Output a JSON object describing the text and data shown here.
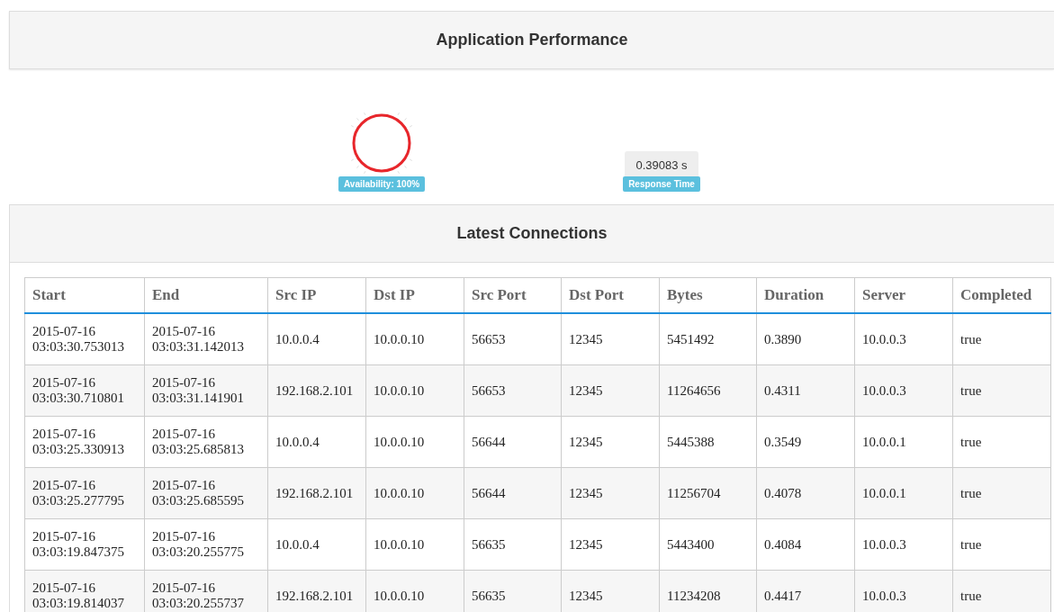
{
  "performance_panel": {
    "title": "Application Performance",
    "availability": {
      "label": "Availability: 100%"
    },
    "response_time": {
      "value": "0.39083 s",
      "label": "Response Time"
    }
  },
  "connections_panel": {
    "title": "Latest Connections",
    "table": {
      "columns": [
        "Start",
        "End",
        "Src IP",
        "Dst IP",
        "Src Port",
        "Dst Port",
        "Bytes",
        "Duration",
        "Server",
        "Completed"
      ],
      "rows": [
        [
          "2015-07-16 03:03:30.753013",
          "2015-07-16 03:03:31.142013",
          "10.0.0.4",
          "10.0.0.10",
          "56653",
          "12345",
          "5451492",
          "0.3890",
          "10.0.0.3",
          "true"
        ],
        [
          "2015-07-16 03:03:30.710801",
          "2015-07-16 03:03:31.141901",
          "192.168.2.101",
          "10.0.0.10",
          "56653",
          "12345",
          "11264656",
          "0.4311",
          "10.0.0.3",
          "true"
        ],
        [
          "2015-07-16 03:03:25.330913",
          "2015-07-16 03:03:25.685813",
          "10.0.0.4",
          "10.0.0.10",
          "56644",
          "12345",
          "5445388",
          "0.3549",
          "10.0.0.1",
          "true"
        ],
        [
          "2015-07-16 03:03:25.277795",
          "2015-07-16 03:03:25.685595",
          "192.168.2.101",
          "10.0.0.10",
          "56644",
          "12345",
          "11256704",
          "0.4078",
          "10.0.0.1",
          "true"
        ],
        [
          "2015-07-16 03:03:19.847375",
          "2015-07-16 03:03:20.255775",
          "10.0.0.4",
          "10.0.0.10",
          "56635",
          "12345",
          "5443400",
          "0.4084",
          "10.0.0.3",
          "true"
        ],
        [
          "2015-07-16 03:03:19.814037",
          "2015-07-16 03:03:20.255737",
          "192.168.2.101",
          "10.0.0.10",
          "56635",
          "12345",
          "11234208",
          "0.4417",
          "10.0.0.3",
          "true"
        ]
      ]
    }
  }
}
